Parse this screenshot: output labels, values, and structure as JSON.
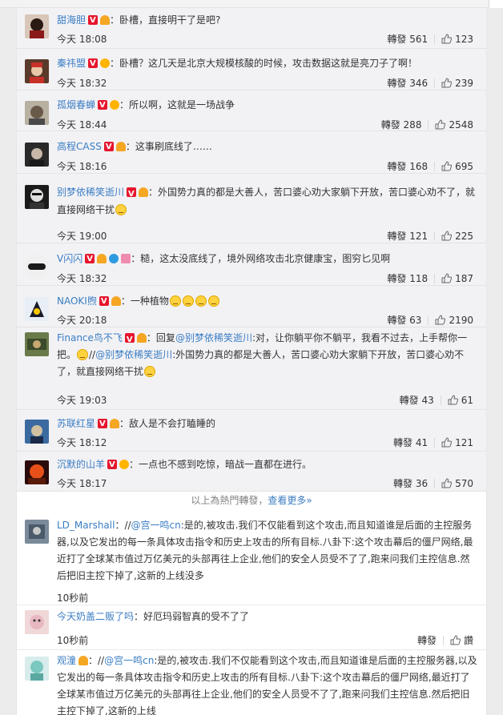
{
  "ui": {
    "repost": "轉發",
    "divider_text": "以上為熱門轉發，",
    "see_more": "查看更多»"
  },
  "comments": [
    {
      "user": "甜海胆",
      "text": "：卧槽，直接明干了是吧?",
      "time": "今天 18:08",
      "reposts": "561",
      "likes": "123"
    },
    {
      "user": "秦祎盟",
      "text": "：卧槽？这几天是北京大规模核酸的时候，攻击数据这就是亮刀子了啊！",
      "time": "今天 18:32",
      "reposts": "346",
      "likes": "239"
    },
    {
      "user": "孤烟春蝉",
      "text": "：所以啊，这就是一场战争",
      "time": "今天 18:44",
      "reposts": "288",
      "likes": "2548"
    },
    {
      "user": "高程CASS",
      "text": "：这事刷底线了……",
      "time": "今天 18:16",
      "reposts": "168",
      "likes": "695"
    },
    {
      "user": "别梦依稀笑逝川",
      "text": "：外国势力真的都是大善人，苦口婆心劝大家躺下开放，苦口婆心劝不了，就直接网络干扰",
      "time": "今天 19:00",
      "reposts": "121",
      "likes": "225"
    },
    {
      "user": "V闪闪",
      "text": "：糙，这太没底线了，境外网络攻击北京健康宝，图穷匕见啊",
      "time": "今天 18:32",
      "reposts": "118",
      "likes": "187"
    },
    {
      "user": "NAOKI煦",
      "text": "：一种植物",
      "time": "今天 20:18",
      "reposts": "63",
      "likes": "2190"
    },
    {
      "user": "Finance鸟不飞",
      "pre": "：回复",
      "mention1": "@别梦依稀笑逝川",
      "text_a": ":对，让你躺平你不躺平，我看不过去，上手帮你一把。",
      "sep": "//",
      "mention2": "@别梦依稀笑逝川",
      "text_b": ":外国势力真的都是大善人，苦口婆心劝大家躺下开放，苦口婆心劝不了，就直接网络干扰",
      "time": "今天 19:03",
      "reposts": "43",
      "likes": "61"
    },
    {
      "user": "苏联红星",
      "text": "：敌人是不会打瞌睡的",
      "time": "今天 18:12",
      "reposts": "41",
      "likes": "121"
    },
    {
      "user": "沉默的山羊",
      "text": "：一点也不感到吃惊，暗战一直都在进行。",
      "time": "今天 18:17",
      "reposts": "36",
      "likes": "570"
    }
  ],
  "normal": [
    {
      "user": "LD_Marshall",
      "sep": "：//",
      "mention": "@宫一鸣cn",
      "text": ":是的,被攻击.我们不仅能看到这个攻击,而且知道谁是后面的主控服务器,以及它发出的每一条具体攻击指令和历史上攻击的所有目标.八卦下:这个攻击幕后的僵尸网络,最近打了全球某市值过万亿美元的头部再往上企业,他们的安全人员受不了了,跑来问我们主控信息.然后把旧主控下掉了,这新的上线没多",
      "time": "10秒前"
    },
    {
      "user": "今天奶盖二贩了吗",
      "text": "：好厄玛弱智真的受不了了",
      "time": "10秒前",
      "like_label": "讚"
    },
    {
      "user": "观潼",
      "sep": "：//",
      "mention": "@宫一鸣cn",
      "text": ":是的,被攻击.我们不仅能看到这个攻击,而且知道谁是后面的主控服务器,以及它发出的每一条具体攻击指令和历史上攻击的所有目标.八卦下:这个攻击幕后的僵尸网络,最近打了全球某市值过万亿美元的头部再往上企业,他们的安全人员受不了了,跑来问我们主控信息.然后把旧主控下掉了,这新的上线"
    }
  ]
}
